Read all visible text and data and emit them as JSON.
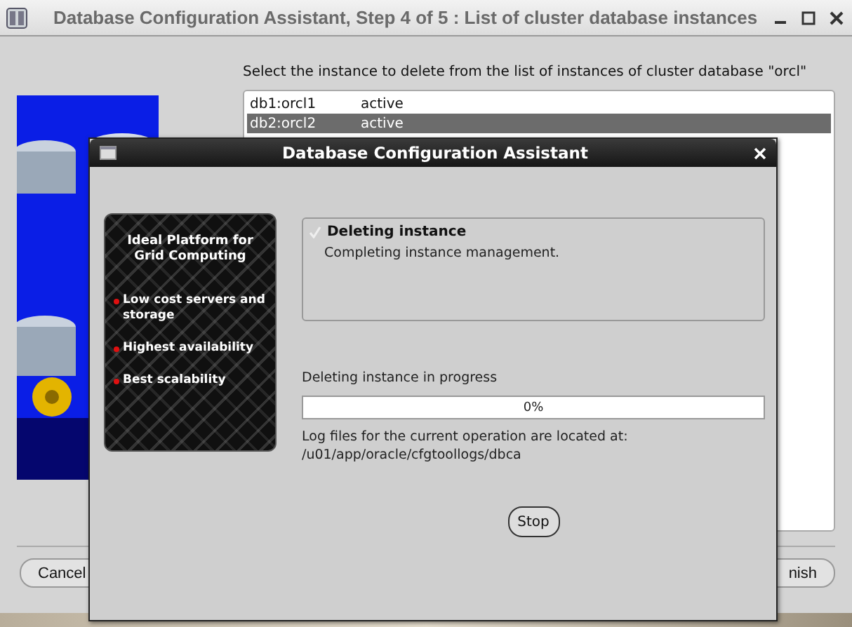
{
  "window": {
    "title": "Database Configuration Assistant, Step 4 of 5 : List of cluster database instances",
    "instruction": "Select the instance to delete from the list of instances of cluster database \"orcl\"",
    "instances": [
      {
        "name": "db1:orcl1",
        "status": "active",
        "selected": false
      },
      {
        "name": "db2:orcl2",
        "status": "active",
        "selected": true
      }
    ],
    "buttons": [
      {
        "label": "Cancel",
        "kind": "left"
      },
      {
        "label": "nish",
        "kind": "right"
      }
    ]
  },
  "dialog": {
    "title": "Database Configuration Assistant",
    "banner": {
      "heading": "Ideal Platform for Grid Computing",
      "points": [
        "Low cost servers and storage",
        "Highest availability",
        "Best scalability"
      ]
    },
    "step": {
      "title": "Deleting instance",
      "detail": "Completing instance management."
    },
    "progress": {
      "label": "Deleting instance in progress",
      "level": 0,
      "reading": "0%"
    },
    "log_note": "Log files for the current operation are located at:",
    "log_path": "/u01/app/oracle/cfgtoollogs/dbca",
    "buttons": [
      "Stop"
    ]
  }
}
